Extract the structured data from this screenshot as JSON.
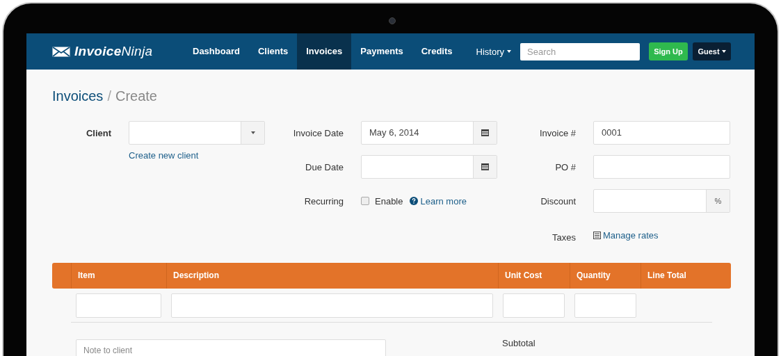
{
  "navbar": {
    "logo": "**Invoice**Ninja",
    "items": [
      {
        "label": "Dashboard",
        "selected": false
      },
      {
        "label": "Clients",
        "selected": false
      },
      {
        "label": "Invoices",
        "selected": true
      },
      {
        "label": "Payments",
        "selected": false
      },
      {
        "label": "Credits",
        "selected": false
      }
    ],
    "history": "History",
    "search": {
      "placeholder": "Search"
    },
    "signup": "Sign Up",
    "user": "Guest"
  },
  "breadcrumb": [
    "Invoices",
    "Create"
  ],
  "breadcrumb_separator": "/",
  "form": {
    "columns": [
      {
        "fields": [
          {
            "kind": "select",
            "label": "Client",
            "link": "Create new client"
          }
        ]
      },
      {
        "fields": [
          {
            "kind": "date",
            "label": "Invoice Date",
            "value": "May 6, 2014"
          },
          {
            "kind": "date",
            "label": "Due Date"
          },
          {
            "kind": "checkbox",
            "label": "Recurring",
            "option": "Enable",
            "checked": false,
            "help": "Learn more"
          }
        ]
      },
      {
        "fields": [
          {
            "kind": "text",
            "label": "Invoice #",
            "value": "0001"
          },
          {
            "kind": "text",
            "label": "PO #"
          },
          {
            "kind": "addon",
            "label": "Discount",
            "addon": "%"
          },
          {
            "kind": "link",
            "label": "Taxes",
            "link": "Manage rates"
          }
        ]
      }
    ]
  },
  "table": {
    "columns": [
      "Item",
      "Description",
      "Unit Cost",
      "Quantity",
      "Line Total"
    ]
  },
  "footer": {
    "note": {
      "placeholder": "Note to client"
    },
    "subtotal": "Subtotal"
  }
}
